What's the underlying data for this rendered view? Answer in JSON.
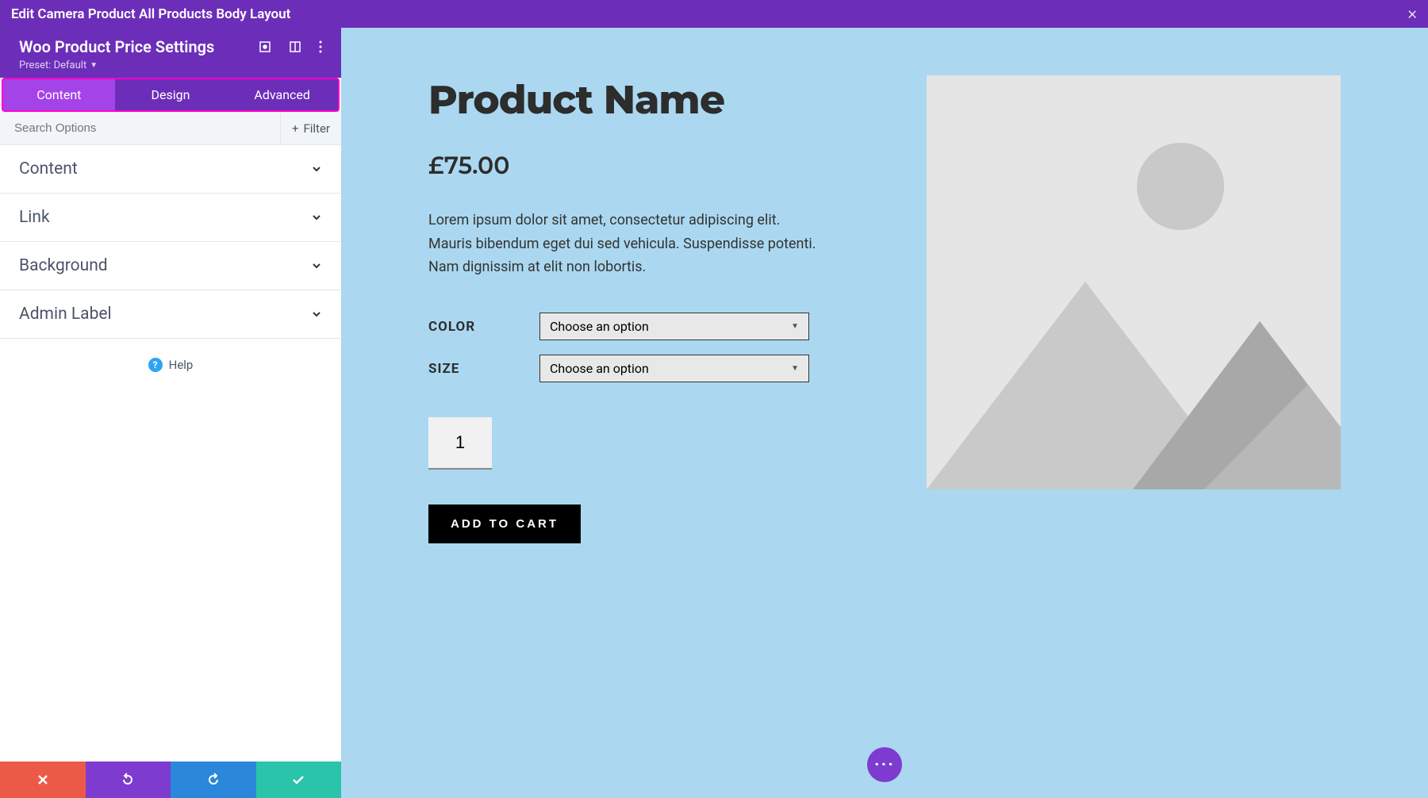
{
  "titlebar": {
    "title": "Edit Camera Product All Products Body Layout"
  },
  "settings": {
    "title": "Woo Product Price Settings",
    "preset": "Preset: Default"
  },
  "tabs": {
    "content": "Content",
    "design": "Design",
    "advanced": "Advanced"
  },
  "search": {
    "placeholder": "Search Options",
    "filter": "Filter"
  },
  "accordions": {
    "content": "Content",
    "link": "Link",
    "background": "Background",
    "admin_label": "Admin Label"
  },
  "help_label": "Help",
  "product": {
    "name": "Product Name",
    "price": "£75.00",
    "description": "Lorem ipsum dolor sit amet, consectetur adipiscing elit. Mauris bibendum eget dui sed vehicula. Suspendisse potenti. Nam dignissim at elit non lobortis.",
    "color_label": "COLOR",
    "size_label": "SIZE",
    "select_placeholder": "Choose an option",
    "qty": "1",
    "add_to_cart": "ADD TO CART"
  }
}
